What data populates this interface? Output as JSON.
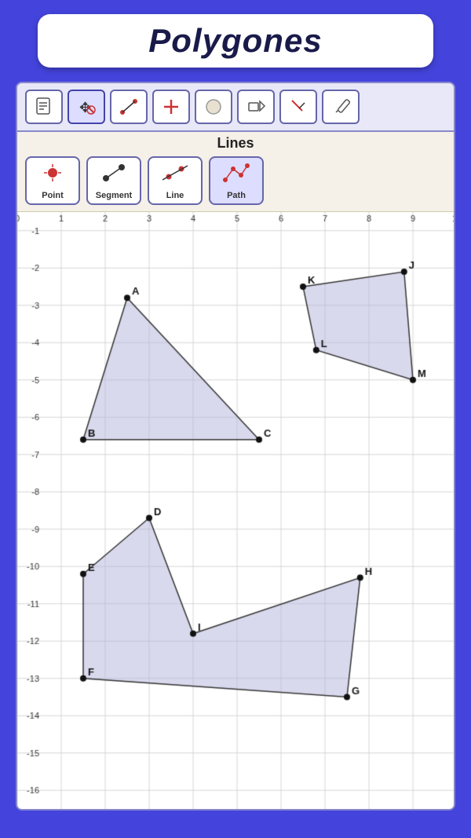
{
  "title": "Polygones",
  "toolbar": {
    "tools": [
      {
        "name": "document",
        "icon": "📄",
        "active": false
      },
      {
        "name": "move",
        "icon": "✥",
        "active": true
      },
      {
        "name": "segment-tool",
        "icon": "╱",
        "active": false
      },
      {
        "name": "plus",
        "icon": "✚",
        "active": false
      },
      {
        "name": "circle",
        "icon": "○",
        "active": false
      },
      {
        "name": "shape",
        "icon": "⬡",
        "active": false
      },
      {
        "name": "delete",
        "icon": "✗",
        "active": false
      },
      {
        "name": "pencil",
        "icon": "✏",
        "active": false
      }
    ]
  },
  "lines_section": {
    "label": "Lines",
    "tools": [
      {
        "name": "Point",
        "active": false
      },
      {
        "name": "Segment",
        "active": false
      },
      {
        "name": "Line",
        "active": false
      },
      {
        "name": "Path",
        "active": true
      }
    ]
  },
  "graph": {
    "x_range": [
      0,
      10
    ],
    "y_range": [
      -16,
      0
    ],
    "polygons": [
      {
        "id": "triangle",
        "points": [
          {
            "label": "A",
            "x": 2.5,
            "y": -2.8
          },
          {
            "label": "B",
            "x": 1.5,
            "y": -6.6
          },
          {
            "label": "C",
            "x": 5.5,
            "y": -6.6
          }
        ],
        "fill": "rgba(180,180,220,0.5)"
      },
      {
        "id": "kite",
        "points": [
          {
            "label": "K",
            "x": 6.5,
            "y": -2.5
          },
          {
            "label": "J",
            "x": 8.8,
            "y": -2.1
          },
          {
            "label": "M",
            "x": 9.0,
            "y": -5.0
          },
          {
            "label": "L",
            "x": 6.8,
            "y": -4.2
          }
        ],
        "fill": "rgba(180,180,220,0.5)"
      },
      {
        "id": "irregular",
        "points": [
          {
            "label": "D",
            "x": 3.0,
            "y": -8.7
          },
          {
            "label": "E",
            "x": 1.5,
            "y": -10.2
          },
          {
            "label": "F",
            "x": 1.5,
            "y": -13.0
          },
          {
            "label": "G",
            "x": 7.5,
            "y": -13.5
          },
          {
            "label": "H",
            "x": 7.8,
            "y": -10.3
          },
          {
            "label": "I",
            "x": 4.0,
            "y": -11.8
          }
        ],
        "fill": "rgba(180,180,220,0.5)"
      }
    ]
  }
}
